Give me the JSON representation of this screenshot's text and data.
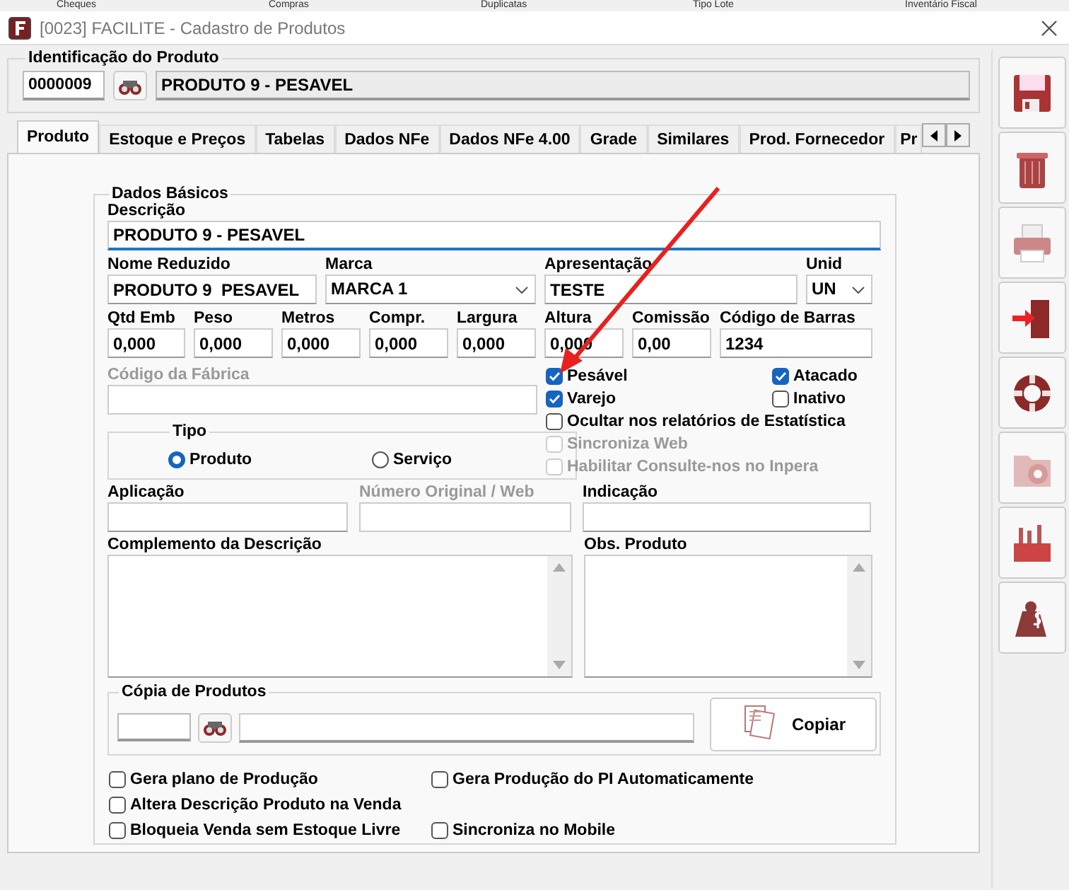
{
  "background_menu": [
    "Cheques",
    "Compras",
    "Duplicatas",
    "Tipo Lote",
    "Inventário Fiscal"
  ],
  "window": {
    "title": "[0023] FACILITE - Cadastro de Produtos"
  },
  "product_id": {
    "title": "Identificação do Produto",
    "code": "0000009",
    "name": "PRODUTO 9 - PESAVEL"
  },
  "tabs": [
    {
      "label": "Produto",
      "selected": true
    },
    {
      "label": "Estoque e Preços",
      "selected": false
    },
    {
      "label": "Tabelas",
      "selected": false
    },
    {
      "label": "Dados NFe",
      "selected": false
    },
    {
      "label": "Dados NFe 4.00",
      "selected": false
    },
    {
      "label": "Grade",
      "selected": false
    },
    {
      "label": "Similares",
      "selected": false
    },
    {
      "label": "Prod. Fornecedor",
      "selected": false
    },
    {
      "label": "Pr",
      "selected": false
    }
  ],
  "basic_data": {
    "title": "Dados Básicos",
    "description": {
      "label": "Descrição",
      "value": "PRODUTO 9 - PESAVEL"
    },
    "row_1": [
      {
        "label": "Nome Reduzido",
        "value": "PRODUTO 9  PESAVEL",
        "kind": "text"
      },
      {
        "label": "Marca",
        "value": "MARCA 1",
        "kind": "select"
      },
      {
        "label": "Apresentação",
        "value": "TESTE",
        "kind": "text"
      },
      {
        "label": "Unid",
        "value": "UN",
        "kind": "select"
      }
    ],
    "row_2": [
      {
        "label": "Qtd Emb",
        "value": "0,000"
      },
      {
        "label": "Peso",
        "value": "0,000"
      },
      {
        "label": "Metros",
        "value": "0,000"
      },
      {
        "label": "Compr.",
        "value": "0,000"
      },
      {
        "label": "Largura",
        "value": "0,000"
      },
      {
        "label": "Altura",
        "value": "0,000"
      },
      {
        "label": "Comissão",
        "value": "0,00"
      },
      {
        "label": "Código de Barras",
        "value": "1234"
      }
    ],
    "factory_code": {
      "label": "Código da Fábrica",
      "disabled": true
    },
    "options": [
      {
        "label": "Pesável",
        "checked": true,
        "disabled": false
      },
      {
        "label": "Atacado",
        "checked": true,
        "disabled": false
      },
      {
        "label": "Varejo",
        "checked": true,
        "disabled": false
      },
      {
        "label": "Inativo",
        "checked": false,
        "disabled": false
      },
      {
        "label": "Ocultar nos relatórios de Estatística",
        "checked": false,
        "disabled": false
      },
      {
        "label": "Sincroniza Web",
        "checked": false,
        "disabled": true
      },
      {
        "label": "Habilitar Consulte-nos no Inpera",
        "checked": false,
        "disabled": true
      }
    ],
    "type_group": {
      "title": "Tipo",
      "options": [
        {
          "label": "Produto",
          "selected": true
        },
        {
          "label": "Serviço",
          "selected": false
        }
      ]
    },
    "row_3": [
      {
        "label": "Aplicação",
        "disabled": false
      },
      {
        "label": "Número Original / Web",
        "disabled": true
      },
      {
        "label": "Indicação",
        "disabled": false
      }
    ],
    "memo_fields": [
      {
        "label": "Complemento da Descrição"
      },
      {
        "label": "Obs. Produto"
      }
    ],
    "copy_group": {
      "title": "Cópia de Produtos",
      "button": "Copiar"
    }
  },
  "flags": [
    {
      "label": "Gera plano de Produção",
      "checked": false
    },
    {
      "label": "Gera Produção do PI Automaticamente",
      "checked": false
    },
    {
      "label": "Altera Descrição Produto na Venda",
      "checked": false
    },
    {
      "label": "Bloqueia Venda sem Estoque Livre",
      "checked": false
    },
    {
      "label": "Sincroniza no Mobile",
      "checked": false
    }
  ]
}
